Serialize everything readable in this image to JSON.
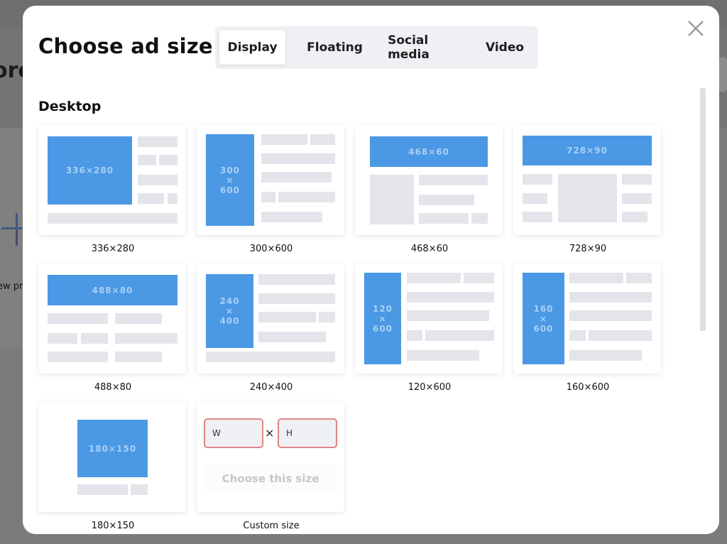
{
  "background": {
    "heading_fragment": "oro",
    "new_project_fragment": "ew pr"
  },
  "modal": {
    "title": "Choose ad size",
    "close_icon": "close-icon",
    "tabs": [
      {
        "label": "Display",
        "active": true
      },
      {
        "label": "Floating",
        "active": false
      },
      {
        "label": "Social media",
        "active": false
      },
      {
        "label": "Video",
        "active": false
      }
    ],
    "section_title": "Desktop",
    "accent_color": "#4b98e4",
    "sizes": [
      {
        "label": "336×280",
        "ad_text": "336×280"
      },
      {
        "label": "300×600",
        "ad_text_lines": [
          "300",
          "×",
          "600"
        ]
      },
      {
        "label": "468×60",
        "ad_text": "468×60"
      },
      {
        "label": "728×90",
        "ad_text": "728×90"
      },
      {
        "label": "488×80",
        "ad_text": "488×80"
      },
      {
        "label": "240×400",
        "ad_text_lines": [
          "240",
          "×",
          "400"
        ]
      },
      {
        "label": "120×600",
        "ad_text_lines": [
          "120",
          "×",
          "600"
        ]
      },
      {
        "label": "160×600",
        "ad_text_lines": [
          "160",
          "×",
          "600"
        ]
      },
      {
        "label": "180×150",
        "ad_text": "180×150"
      }
    ],
    "custom": {
      "label": "Custom size",
      "width_placeholder": "W",
      "height_placeholder": "H",
      "times_symbol": "×",
      "button_label": "Choose this size"
    }
  }
}
